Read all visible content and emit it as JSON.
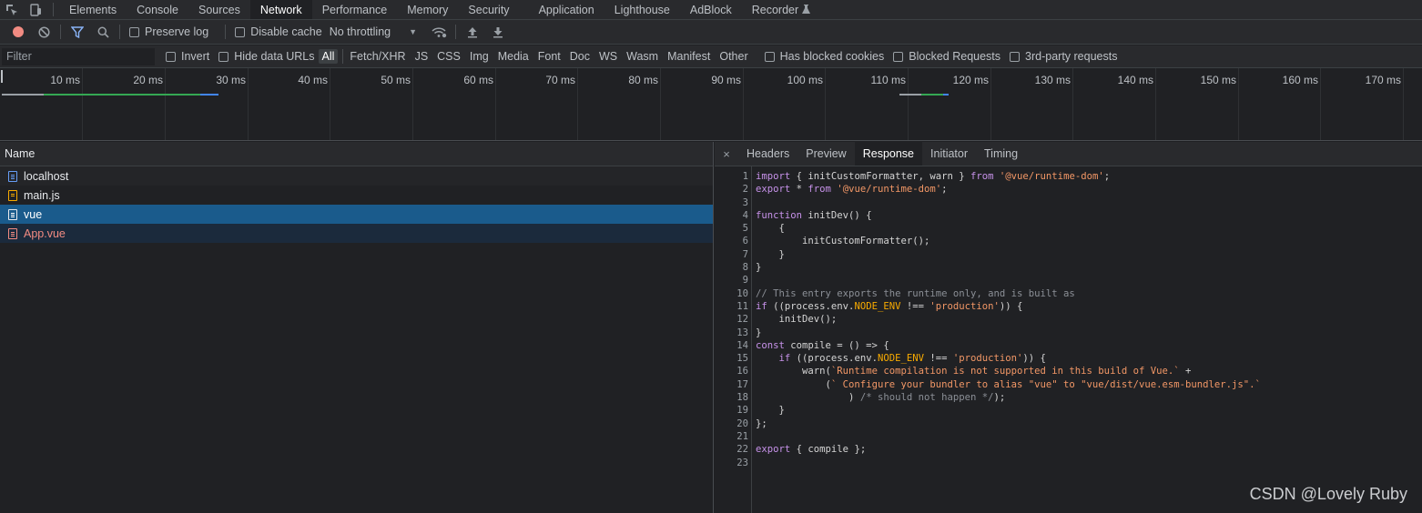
{
  "tabs": [
    "Elements",
    "Console",
    "Sources",
    "Network",
    "Performance",
    "Memory",
    "Security",
    "Application",
    "Lighthouse",
    "AdBlock",
    "Recorder"
  ],
  "active_tab": "Network",
  "toolbar": {
    "preserve_log": "Preserve log",
    "disable_cache": "Disable cache",
    "throttling": "No throttling"
  },
  "filterbar": {
    "filter_placeholder": "Filter",
    "invert": "Invert",
    "hide_data_urls": "Hide data URLs",
    "types": [
      "All",
      "Fetch/XHR",
      "JS",
      "CSS",
      "Img",
      "Media",
      "Font",
      "Doc",
      "WS",
      "Wasm",
      "Manifest",
      "Other"
    ],
    "active_type": "All",
    "has_blocked_cookies": "Has blocked cookies",
    "blocked_requests": "Blocked Requests",
    "third_party": "3rd-party requests"
  },
  "timeline": {
    "ticks": [
      "10 ms",
      "20 ms",
      "30 ms",
      "40 ms",
      "50 ms",
      "60 ms",
      "70 ms",
      "80 ms",
      "90 ms",
      "100 ms",
      "110 ms",
      "120 ms",
      "130 ms",
      "140 ms",
      "150 ms",
      "160 ms",
      "170 ms"
    ]
  },
  "requests": {
    "column_name": "Name",
    "rows": [
      {
        "name": "localhost",
        "type": "doc"
      },
      {
        "name": "main.js",
        "type": "js"
      },
      {
        "name": "vue",
        "type": "selected"
      },
      {
        "name": "App.vue",
        "type": "error"
      }
    ]
  },
  "detail": {
    "close": "×",
    "tabs": [
      "Headers",
      "Preview",
      "Response",
      "Initiator",
      "Timing"
    ],
    "active_tab": "Response",
    "line_numbers": [
      "1",
      "2",
      "3",
      "4",
      "5",
      "6",
      "7",
      "8",
      "9",
      "10",
      "11",
      "12",
      "13",
      "14",
      "15",
      "16",
      "17",
      "18",
      "19",
      "20",
      "21",
      "22",
      "23"
    ],
    "code": {
      "l1a": "import",
      "l1b": " { initCustomFormatter, warn } ",
      "l1c": "from",
      "l1d": " ",
      "l1e": "'@vue/runtime-dom'",
      "l1f": ";",
      "l2a": "export",
      "l2b": " * ",
      "l2c": "from",
      "l2d": " ",
      "l2e": "'@vue/runtime-dom'",
      "l2f": ";",
      "l4a": "function",
      "l4b": " initDev() {",
      "l5": "    {",
      "l6": "        initCustomFormatter();",
      "l7": "    }",
      "l8": "}",
      "l10": "// This entry exports the runtime only, and is built as",
      "l11a": "if",
      "l11b": " ((process.env.",
      "l11c": "NODE_ENV",
      "l11d": " !== ",
      "l11e": "'production'",
      "l11f": ")) {",
      "l12": "    initDev();",
      "l13": "}",
      "l14a": "const",
      "l14b": " compile = () => {",
      "l15a": "    if",
      "l15b": " ((process.env.",
      "l15c": "NODE_ENV",
      "l15d": " !== ",
      "l15e": "'production'",
      "l15f": ")) {",
      "l16a": "        warn(",
      "l16b": "`Runtime compilation is not supported in this build of Vue.`",
      "l16c": " +",
      "l17a": "            (",
      "l17b": "` Configure your bundler to alias \"vue\" to \"vue/dist/vue.esm-bundler.js\".`",
      "l18a": "                ) ",
      "l18b": "/* should not happen */",
      "l18c": ");",
      "l19": "    }",
      "l20": "};",
      "l22a": "export",
      "l22b": " { compile };"
    }
  },
  "watermark": "CSDN @Lovely Ruby",
  "colors": {
    "selected_row": "#1a5b8c",
    "error_text": "#f28b82",
    "keyword": "#c792ea",
    "string": "#f29766"
  }
}
